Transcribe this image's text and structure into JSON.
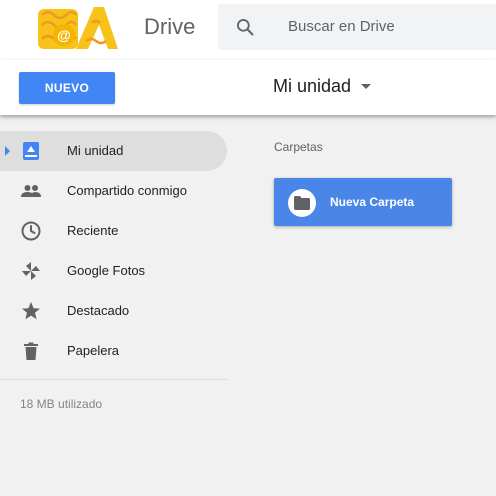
{
  "header": {
    "app_title": "Drive",
    "search_placeholder": "Buscar en Drive"
  },
  "toolbar": {
    "new_label": "NUEVO",
    "breadcrumb": "Mi unidad"
  },
  "sidebar": {
    "items": [
      {
        "label": "Mi unidad",
        "icon": "my-drive-icon",
        "active": true
      },
      {
        "label": "Compartido conmigo",
        "icon": "people-icon"
      },
      {
        "label": "Reciente",
        "icon": "clock-icon"
      },
      {
        "label": "Google Fotos",
        "icon": "pinwheel-icon"
      },
      {
        "label": "Destacado",
        "icon": "star-icon"
      },
      {
        "label": "Papelera",
        "icon": "trash-icon"
      }
    ],
    "storage_text": "18 MB utilizado"
  },
  "main": {
    "section_title": "Carpetas",
    "folders": [
      {
        "label": "Nueva Carpeta",
        "icon": "folder-icon"
      }
    ]
  },
  "colors": {
    "accent": "#4285f4",
    "folder_card": "#4a86e8",
    "logo_yellow": "#f7c31b",
    "logo_orange": "#f29a1e"
  }
}
